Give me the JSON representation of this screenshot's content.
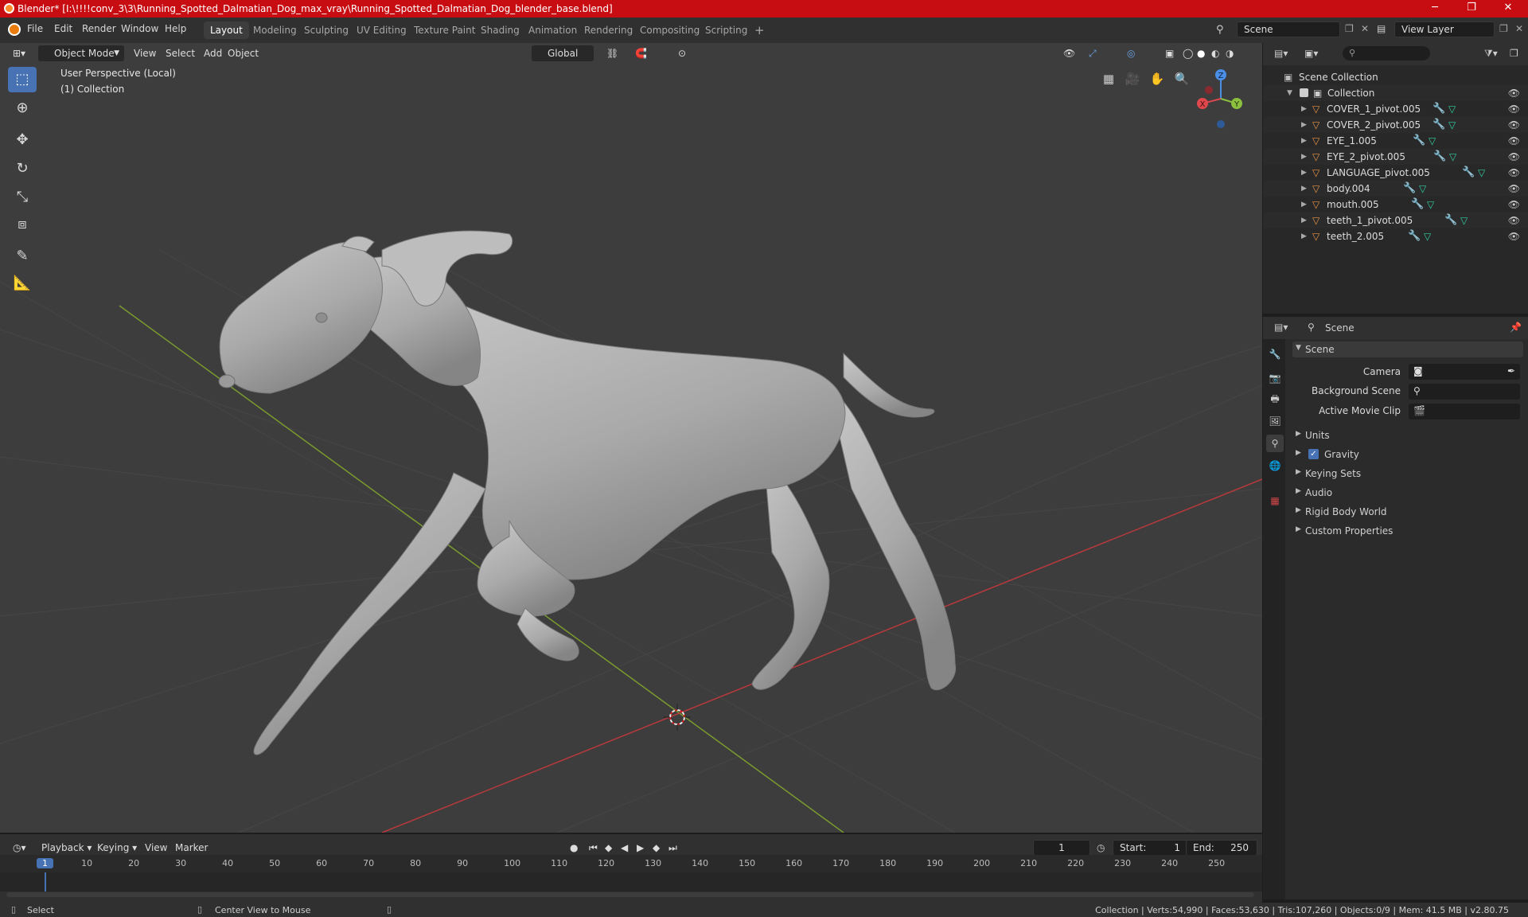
{
  "window": {
    "title": "Blender* [I:\\!!!!conv_3\\3\\Running_Spotted_Dalmatian_Dog_max_vray\\Running_Spotted_Dalmatian_Dog_blender_base.blend]",
    "minimize": "─",
    "maximize": "❐",
    "close": "✕"
  },
  "menu": [
    "File",
    "Edit",
    "Render",
    "Window",
    "Help"
  ],
  "workspaces": [
    "Layout",
    "Modeling",
    "Sculpting",
    "UV Editing",
    "Texture Paint",
    "Shading",
    "Animation",
    "Rendering",
    "Compositing",
    "Scripting"
  ],
  "scene": {
    "name": "Scene",
    "view_layer": "View Layer"
  },
  "viewport_header": {
    "mode": "Object Mode",
    "menus": [
      "View",
      "Select",
      "Add",
      "Object"
    ],
    "orientation": "Global"
  },
  "viewport_overlay": {
    "perspective": "User Perspective (Local)",
    "collection": "(1) Collection"
  },
  "gizmo": {
    "x": "X",
    "y": "Y",
    "z": "Z"
  },
  "outliner": {
    "root": "Scene Collection",
    "collection": "Collection",
    "objects": [
      "COVER_1_pivot.005",
      "COVER_2_pivot.005",
      "EYE_1.005",
      "EYE_2_pivot.005",
      "LANGUAGE_pivot.005",
      "body.004",
      "mouth.005",
      "teeth_1_pivot.005",
      "teeth_2.005"
    ]
  },
  "properties": {
    "context": "Scene",
    "panel": "Scene",
    "camera_label": "Camera",
    "background_scene_label": "Background Scene",
    "active_movie_clip_label": "Active Movie Clip",
    "sections": [
      "Units",
      "Gravity",
      "Keying Sets",
      "Audio",
      "Rigid Body World",
      "Custom Properties"
    ]
  },
  "timeline": {
    "menus": [
      "Playback",
      "Keying",
      "View",
      "Marker"
    ],
    "current_frame": "1",
    "start_label": "Start:",
    "start": "1",
    "end_label": "End:",
    "end": "250",
    "ticks": [
      "1",
      "10",
      "20",
      "30",
      "40",
      "50",
      "60",
      "70",
      "80",
      "90",
      "100",
      "110",
      "120",
      "130",
      "140",
      "150",
      "160",
      "170",
      "180",
      "190",
      "200",
      "210",
      "220",
      "230",
      "240",
      "250"
    ]
  },
  "statusbar": {
    "select": "Select",
    "center": "Center View to Mouse",
    "stats": "Collection | Verts:54,990 | Faces:53,630 | Tris:107,260 | Objects:0/9 | Mem: 41.5 MB | v2.80.75"
  },
  "colors": {
    "titlebar": "#c80d12",
    "accent": "#4772b3",
    "x_axis": "#e0484d",
    "y_axis": "#8bc13f",
    "z_axis": "#4a8ee6"
  }
}
